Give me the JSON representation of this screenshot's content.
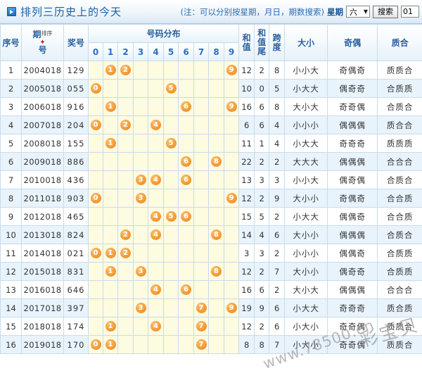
{
  "header": {
    "title": "排列三历史上的今天",
    "badge_icon": "arrow-right-icon",
    "note": "(注：可以分别按星期，月日，期数搜索)",
    "week_label": "星期",
    "week_value": "六",
    "caret": "▼",
    "search_button": "搜索",
    "issue_value": "01"
  },
  "table": {
    "columns": {
      "index": "序号",
      "issue": "期",
      "issue2": "号",
      "issue_sort_hint": "排序",
      "award": "奖号",
      "distribution": "号码分布",
      "digits": [
        "0",
        "1",
        "2",
        "3",
        "4",
        "5",
        "6",
        "7",
        "8",
        "9"
      ],
      "sum": "和值",
      "sum_tail": "和值尾",
      "span": "跨度",
      "size": "大小",
      "parity": "奇偶",
      "prime": "质合"
    },
    "rows": [
      {
        "index": "1",
        "issue": "2004018",
        "award": "129",
        "digits": [
          "1",
          "2",
          "9"
        ],
        "sum": "12",
        "sum_tail": "2",
        "span": "8",
        "size": "小小大",
        "parity": "奇偶奇",
        "prime": "质质合"
      },
      {
        "index": "2",
        "issue": "2005018",
        "award": "055",
        "digits": [
          "0",
          "5",
          "5"
        ],
        "sum": "10",
        "sum_tail": "0",
        "span": "5",
        "size": "小大大",
        "parity": "偶奇奇",
        "prime": "合质质"
      },
      {
        "index": "3",
        "issue": "2006018",
        "award": "916",
        "digits": [
          "9",
          "1",
          "6"
        ],
        "sum": "16",
        "sum_tail": "6",
        "span": "8",
        "size": "大小大",
        "parity": "奇奇偶",
        "prime": "合质合"
      },
      {
        "index": "4",
        "issue": "2007018",
        "award": "204",
        "digits": [
          "2",
          "0",
          "4"
        ],
        "sum": "6",
        "sum_tail": "6",
        "span": "4",
        "size": "小小小",
        "parity": "偶偶偶",
        "prime": "质合合"
      },
      {
        "index": "5",
        "issue": "2008018",
        "award": "155",
        "digits": [
          "1",
          "5",
          "5"
        ],
        "sum": "11",
        "sum_tail": "1",
        "span": "4",
        "size": "小大大",
        "parity": "奇奇奇",
        "prime": "质质质"
      },
      {
        "index": "6",
        "issue": "2009018",
        "award": "886",
        "digits": [
          "8",
          "8",
          "6"
        ],
        "sum": "22",
        "sum_tail": "2",
        "span": "2",
        "size": "大大大",
        "parity": "偶偶偶",
        "prime": "合合合"
      },
      {
        "index": "7",
        "issue": "2010018",
        "award": "436",
        "digits": [
          "4",
          "3",
          "6"
        ],
        "sum": "13",
        "sum_tail": "3",
        "span": "3",
        "size": "小小大",
        "parity": "偶奇偶",
        "prime": "合质合"
      },
      {
        "index": "8",
        "issue": "2011018",
        "award": "903",
        "digits": [
          "9",
          "0",
          "3"
        ],
        "sum": "12",
        "sum_tail": "2",
        "span": "9",
        "size": "大小小",
        "parity": "奇偶奇",
        "prime": "合合质"
      },
      {
        "index": "9",
        "issue": "2012018",
        "award": "465",
        "digits": [
          "4",
          "6",
          "5"
        ],
        "sum": "15",
        "sum_tail": "5",
        "span": "2",
        "size": "小大大",
        "parity": "偶偶奇",
        "prime": "合合质"
      },
      {
        "index": "10",
        "issue": "2013018",
        "award": "824",
        "digits": [
          "8",
          "2",
          "4"
        ],
        "sum": "14",
        "sum_tail": "4",
        "span": "6",
        "size": "大小小",
        "parity": "偶偶偶",
        "prime": "合质合"
      },
      {
        "index": "11",
        "issue": "2014018",
        "award": "021",
        "digits": [
          "0",
          "2",
          "1"
        ],
        "sum": "3",
        "sum_tail": "3",
        "span": "2",
        "size": "小小小",
        "parity": "偶偶奇",
        "prime": "合质质"
      },
      {
        "index": "12",
        "issue": "2015018",
        "award": "831",
        "digits": [
          "8",
          "3",
          "1"
        ],
        "sum": "12",
        "sum_tail": "2",
        "span": "7",
        "size": "大小小",
        "parity": "偶奇奇",
        "prime": "合质质"
      },
      {
        "index": "13",
        "issue": "2016018",
        "award": "646",
        "digits": [
          "6",
          "4",
          "6"
        ],
        "sum": "16",
        "sum_tail": "6",
        "span": "2",
        "size": "大小大",
        "parity": "偶偶偶",
        "prime": "合合合"
      },
      {
        "index": "14",
        "issue": "2017018",
        "award": "397",
        "digits": [
          "3",
          "9",
          "7"
        ],
        "sum": "19",
        "sum_tail": "9",
        "span": "6",
        "size": "小大大",
        "parity": "奇奇奇",
        "prime": "质合质"
      },
      {
        "index": "15",
        "issue": "2018018",
        "award": "174",
        "digits": [
          "1",
          "7",
          "4"
        ],
        "sum": "12",
        "sum_tail": "2",
        "span": "6",
        "size": "小大小",
        "parity": "奇奇偶",
        "prime": "质质合"
      },
      {
        "index": "16",
        "issue": "2019018",
        "award": "170",
        "digits": [
          "1",
          "7",
          "0"
        ],
        "sum": "8",
        "sum_tail": "8",
        "span": "7",
        "size": "小大小",
        "parity": "奇奇偶",
        "prime": "质质合"
      }
    ]
  },
  "watermark": {
    "cn": "彩宝贝",
    "url": "www.78500.cn"
  }
}
